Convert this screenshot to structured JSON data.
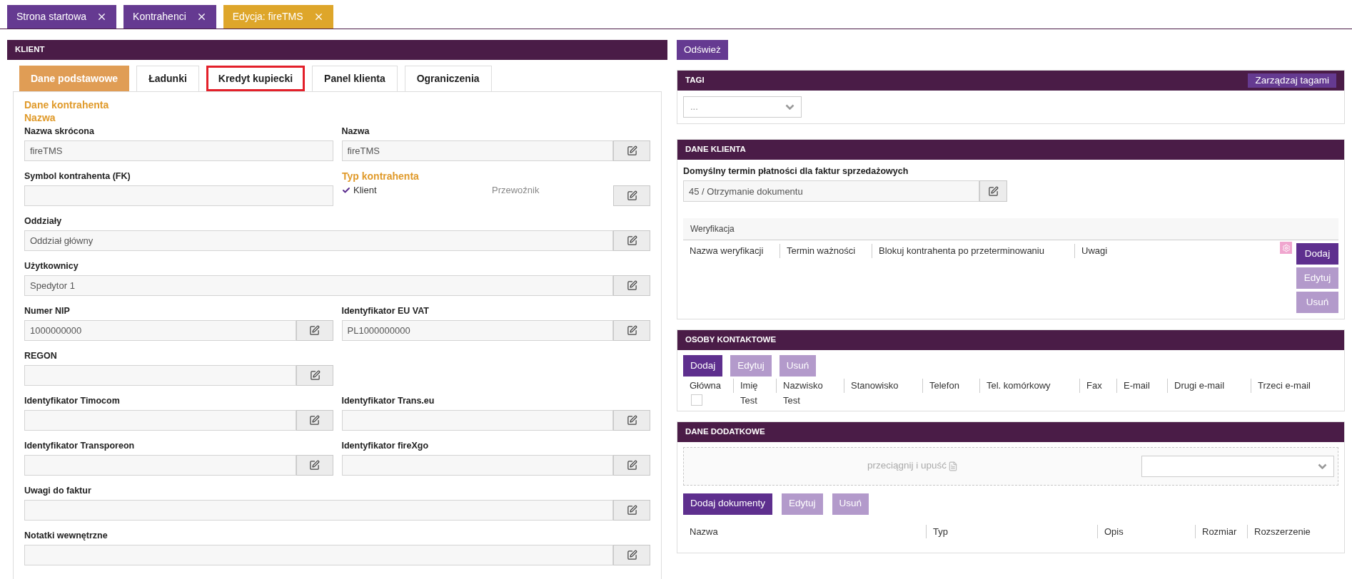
{
  "top_tabs": [
    {
      "label": "Strona startowa",
      "selected": false
    },
    {
      "label": "Kontrahenci",
      "selected": false
    },
    {
      "label": "Edycja: fireTMS",
      "selected": true
    }
  ],
  "client_panel": {
    "title": "KLIENT",
    "tabs": [
      {
        "label": "Dane podstawowe",
        "selected": true,
        "highlighted": false
      },
      {
        "label": "Ładunki",
        "selected": false,
        "highlighted": false
      },
      {
        "label": "Kredyt kupiecki",
        "selected": false,
        "highlighted": true
      },
      {
        "label": "Panel klienta",
        "selected": false,
        "highlighted": false
      },
      {
        "label": "Ograniczenia",
        "selected": false,
        "highlighted": false
      }
    ],
    "section_heading": "Dane kontrahenta",
    "subsection_heading": "Nazwa",
    "rows": [
      [
        {
          "kind": "half",
          "label": "Nazwa skrócona",
          "value": "fireTMS",
          "editable": false
        },
        {
          "kind": "half",
          "label": "Nazwa",
          "value": "fireTMS",
          "editable": true
        }
      ],
      [
        {
          "kind": "half",
          "label": "Symbol kontrahenta (FK)",
          "editable": false
        },
        {
          "kind": "type",
          "label": "Typ kontrahenta",
          "editable": true,
          "options": [
            {
              "label": "Klient",
              "checked": true
            },
            {
              "label": "Przewoźnik",
              "checked": false
            }
          ]
        }
      ],
      [
        {
          "kind": "full",
          "label": "Oddziały",
          "value": "Oddział główny",
          "editable": true
        }
      ],
      [
        {
          "kind": "full",
          "label": "Użytkownicy",
          "value": "Spedytor 1",
          "editable": true
        }
      ],
      [
        {
          "kind": "half",
          "label": "Numer NIP",
          "value": "1000000000",
          "editable": true
        },
        {
          "kind": "half",
          "label": "Identyfikator EU VAT",
          "value": "PL1000000000",
          "editable": true
        }
      ],
      [
        {
          "kind": "half",
          "label": "REGON",
          "editable": true
        }
      ],
      [
        {
          "kind": "half",
          "label": "Identyfikator Timocom",
          "editable": true
        },
        {
          "kind": "half",
          "label": "Identyfikator Trans.eu",
          "editable": true
        }
      ],
      [
        {
          "kind": "half",
          "label": "Identyfikator Transporeon",
          "editable": true
        },
        {
          "kind": "half",
          "label": "Identyfikator fireXgo",
          "editable": true
        }
      ],
      [
        {
          "kind": "full",
          "label": "Uwagi do faktur",
          "editable": true
        }
      ],
      [
        {
          "kind": "full",
          "label": "Notatki wewnętrzne",
          "editable": true
        }
      ]
    ]
  },
  "refresh_button": "Odśwież",
  "tags": {
    "title": "TAGI",
    "manage_button": "Zarządzaj tagami",
    "select_value": "..."
  },
  "client_data": {
    "title": "DANE KLIENTA",
    "payment_label": "Domyślny termin płatności dla faktur sprzedażowych",
    "payment_value": "45 / Otrzymanie dokumentu",
    "verification": {
      "title": "Weryfikacja",
      "columns": [
        "Nazwa weryfikacji",
        "Termin ważności",
        "Blokuj kontrahenta po przeterminowaniu",
        "Uwagi"
      ],
      "buttons": [
        {
          "label": "Dodaj",
          "disabled": false
        },
        {
          "label": "Edytuj",
          "disabled": true
        },
        {
          "label": "Usuń",
          "disabled": true
        }
      ]
    }
  },
  "contacts": {
    "title": "OSOBY KONTAKTOWE",
    "buttons": [
      {
        "label": "Dodaj",
        "disabled": false
      },
      {
        "label": "Edytuj",
        "disabled": true
      },
      {
        "label": "Usuń",
        "disabled": true
      }
    ],
    "columns": [
      "Główna",
      "Imię",
      "Nazwisko",
      "Stanowisko",
      "Telefon",
      "Tel. komórkowy",
      "Fax",
      "E-mail",
      "Drugi e-mail",
      "Trzeci e-mail"
    ],
    "rows": [
      {
        "cells": [
          {
            "kind": "checkbox",
            "checked": false
          },
          {
            "kind": "text",
            "text": "Test"
          },
          {
            "kind": "text",
            "text": "Test"
          }
        ]
      }
    ]
  },
  "extra_data": {
    "title": "DANE DODATKOWE",
    "drop_text": "przeciągnij i upuść",
    "buttons": [
      {
        "label": "Dodaj dokumenty",
        "disabled": false
      },
      {
        "label": "Edytuj",
        "disabled": true
      },
      {
        "label": "Usuń",
        "disabled": true
      }
    ],
    "columns": [
      "Nazwa",
      "Typ",
      "Opis",
      "Rozmiar",
      "Rozszerzenie"
    ]
  }
}
